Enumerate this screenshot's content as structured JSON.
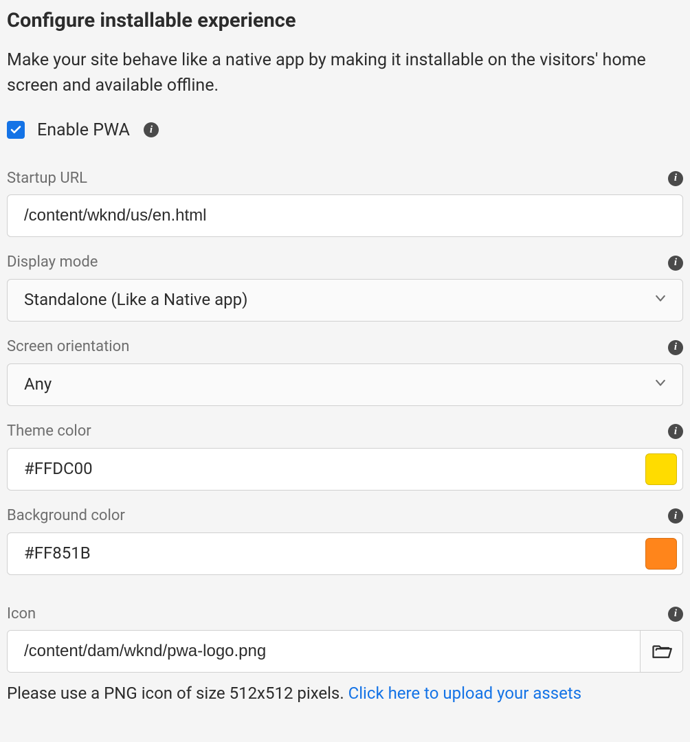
{
  "header": {
    "title": "Configure installable experience",
    "subtitle": "Make your site behave like a native app by making it installable on the visitors' home screen and available offline."
  },
  "enablePwa": {
    "label": "Enable PWA",
    "checked": true
  },
  "fields": {
    "startupUrl": {
      "label": "Startup URL",
      "value": "/content/wknd/us/en.html"
    },
    "displayMode": {
      "label": "Display mode",
      "value": "Standalone (Like a Native app)"
    },
    "screenOrientation": {
      "label": "Screen orientation",
      "value": "Any"
    },
    "themeColor": {
      "label": "Theme color",
      "value": "#FFDC00",
      "swatch": "#FFDC00"
    },
    "backgroundColor": {
      "label": "Background color",
      "value": "#FF851B",
      "swatch": "#FF851B"
    },
    "icon": {
      "label": "Icon",
      "value": "/content/dam/wknd/pwa-logo.png"
    }
  },
  "footer": {
    "text": "Please use a PNG icon of size 512x512 pixels. ",
    "link": "Click here to upload your assets"
  }
}
